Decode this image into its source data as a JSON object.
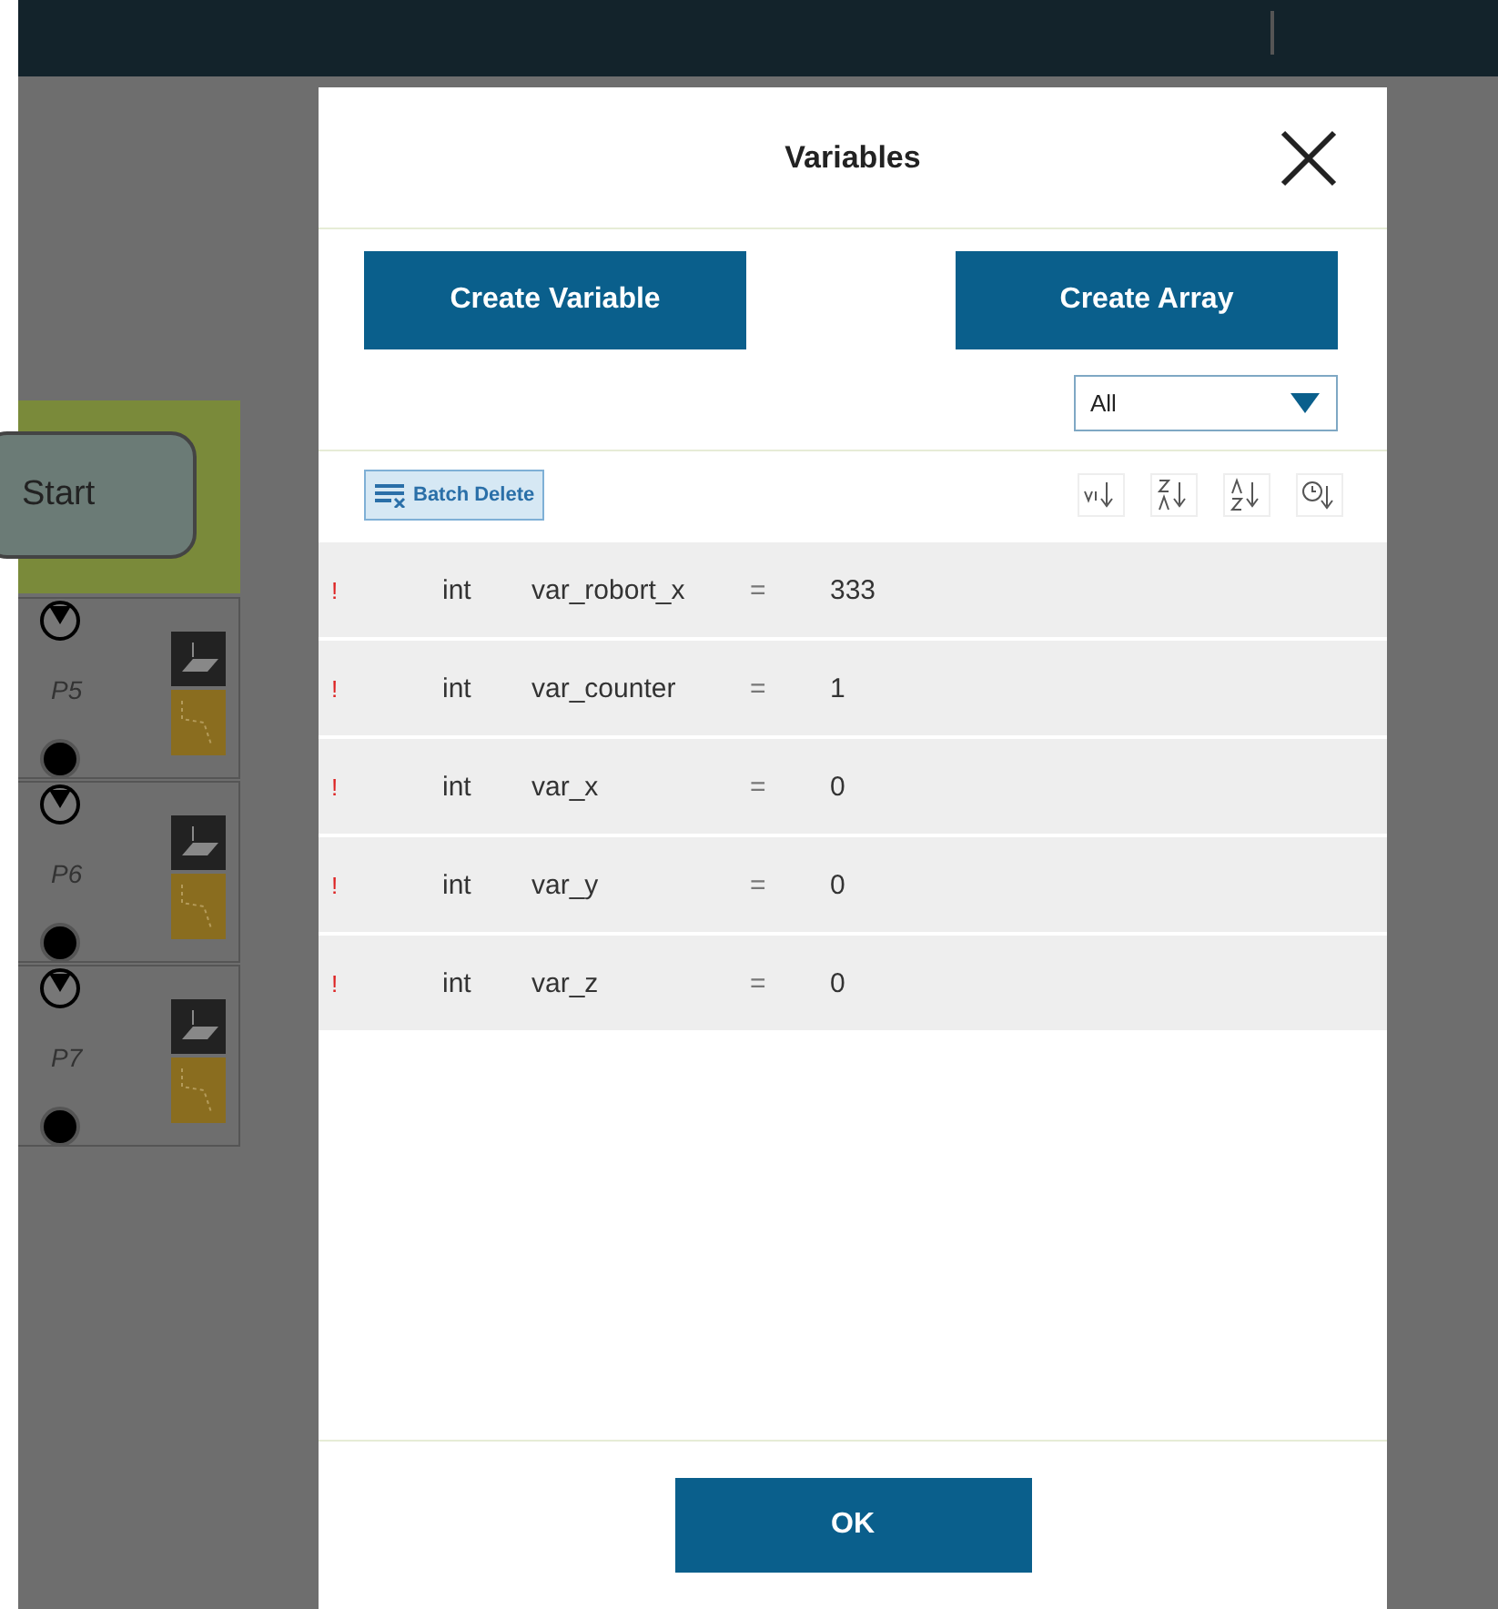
{
  "canvas": {
    "start_label": "Start",
    "blocks": [
      {
        "label": "P5"
      },
      {
        "label": "P6"
      },
      {
        "label": "P7"
      }
    ]
  },
  "dialog": {
    "title": "Variables",
    "buttons": [
      "Create Variable",
      "Create Array"
    ],
    "filter": {
      "value": "All"
    },
    "batch_delete": "Batch Delete",
    "variables": [
      {
        "flag": "!",
        "type": "int",
        "name": "var_robort_x",
        "op": "=",
        "value": "333"
      },
      {
        "flag": "!",
        "type": "int",
        "name": "var_counter",
        "op": "=",
        "value": "1"
      },
      {
        "flag": "!",
        "type": "int",
        "name": "var_x",
        "op": "=",
        "value": "0"
      },
      {
        "flag": "!",
        "type": "int",
        "name": "var_y",
        "op": "=",
        "value": "0"
      },
      {
        "flag": "!",
        "type": "int",
        "name": "var_z",
        "op": "=",
        "value": "0"
      }
    ],
    "ok": "OK"
  }
}
